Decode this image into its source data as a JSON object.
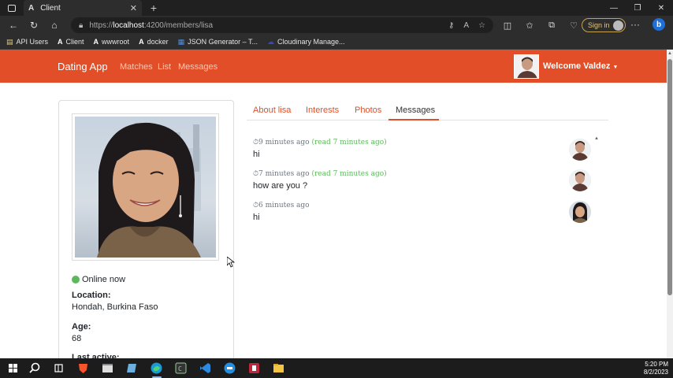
{
  "browser": {
    "tab_title": "Client",
    "tab_favicon": "A",
    "url_prefix": "https://",
    "url_host": "localhost",
    "url_path": ":4200/members/lisa",
    "signin_label": "Sign in",
    "bookmarks": [
      {
        "icon": "folder-icon",
        "label": "API Users"
      },
      {
        "icon": "angular-icon",
        "label": "Client"
      },
      {
        "icon": "angular-icon",
        "label": "wwwroot"
      },
      {
        "icon": "angular-icon",
        "label": "docker"
      },
      {
        "icon": "json-icon",
        "label": "JSON Generator – T..."
      },
      {
        "icon": "cloudinary-icon",
        "label": "Cloudinary Manage..."
      }
    ]
  },
  "navbar": {
    "brand": "Dating App",
    "links": [
      "Matches",
      "List",
      "Messages"
    ],
    "welcome": "Welcome Valdez",
    "color": "#e24e27"
  },
  "profile": {
    "status": "Online now",
    "location_label": "Location:",
    "location": "Hondah, Burkina Faso",
    "age_label": "Age:",
    "age": "68",
    "last_active_label": "Last active:"
  },
  "tabs": [
    "About lisa",
    "Interests",
    "Photos",
    "Messages"
  ],
  "active_tab": "Messages",
  "messages": [
    {
      "time": "9 minutes ago",
      "read": "(read 7 minutes ago)",
      "text": "hi",
      "sender": "valdez"
    },
    {
      "time": "7 minutes ago",
      "read": "(read 7 minutes ago)",
      "text": "how are you ?",
      "sender": "valdez"
    },
    {
      "time": "6 minutes ago",
      "read": "",
      "text": "hi",
      "sender": "lisa"
    }
  ],
  "taskbar": {
    "time": "5:20 PM",
    "date": "8/2/2023"
  }
}
